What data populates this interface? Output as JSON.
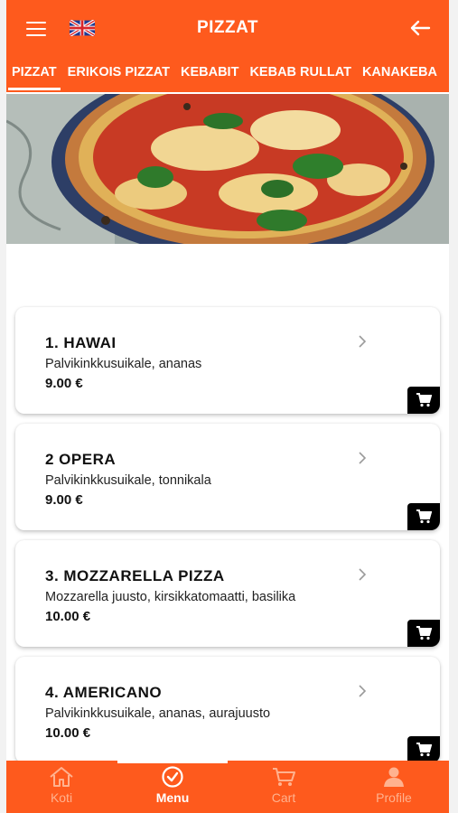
{
  "header": {
    "title": "PIZZAT",
    "accent_color": "#fe5a1d",
    "left_icons": [
      "hamburger-menu-icon",
      "uk-flag-icon"
    ],
    "right_icon": "arrow-left-icon"
  },
  "tabs": [
    {
      "label": "PIZZAT",
      "active": true
    },
    {
      "label": "ERIKOIS PIZZAT",
      "active": false
    },
    {
      "label": "KEBABIT",
      "active": false
    },
    {
      "label": "KEBAB RULLAT",
      "active": false
    },
    {
      "label": "KANAKEBA",
      "active": false
    }
  ],
  "menu_items": [
    {
      "name": "1. HAWAI",
      "description": "Palvikinkkusuikale, ananas",
      "price": "9.00 €"
    },
    {
      "name": "2 OPERA",
      "description": "Palvikinkkusuikale, tonnikala",
      "price": "9.00 €"
    },
    {
      "name": "3. MOZZARELLA PIZZA",
      "description": "Mozzarella juusto, kirsikkatomaatti, basilika",
      "price": "10.00 €"
    },
    {
      "name": "4. AMERICANO",
      "description": "Palvikinkkusuikale, ananas, aurajuusto",
      "price": "10.00 €"
    }
  ],
  "bottom_nav": [
    {
      "label": "Koti",
      "icon": "home-icon",
      "active": false
    },
    {
      "label": "Menu",
      "icon": "check-circle-icon",
      "active": true
    },
    {
      "label": "Cart",
      "icon": "cart-icon",
      "active": false
    },
    {
      "label": "Profile",
      "icon": "person-icon",
      "active": false
    }
  ]
}
